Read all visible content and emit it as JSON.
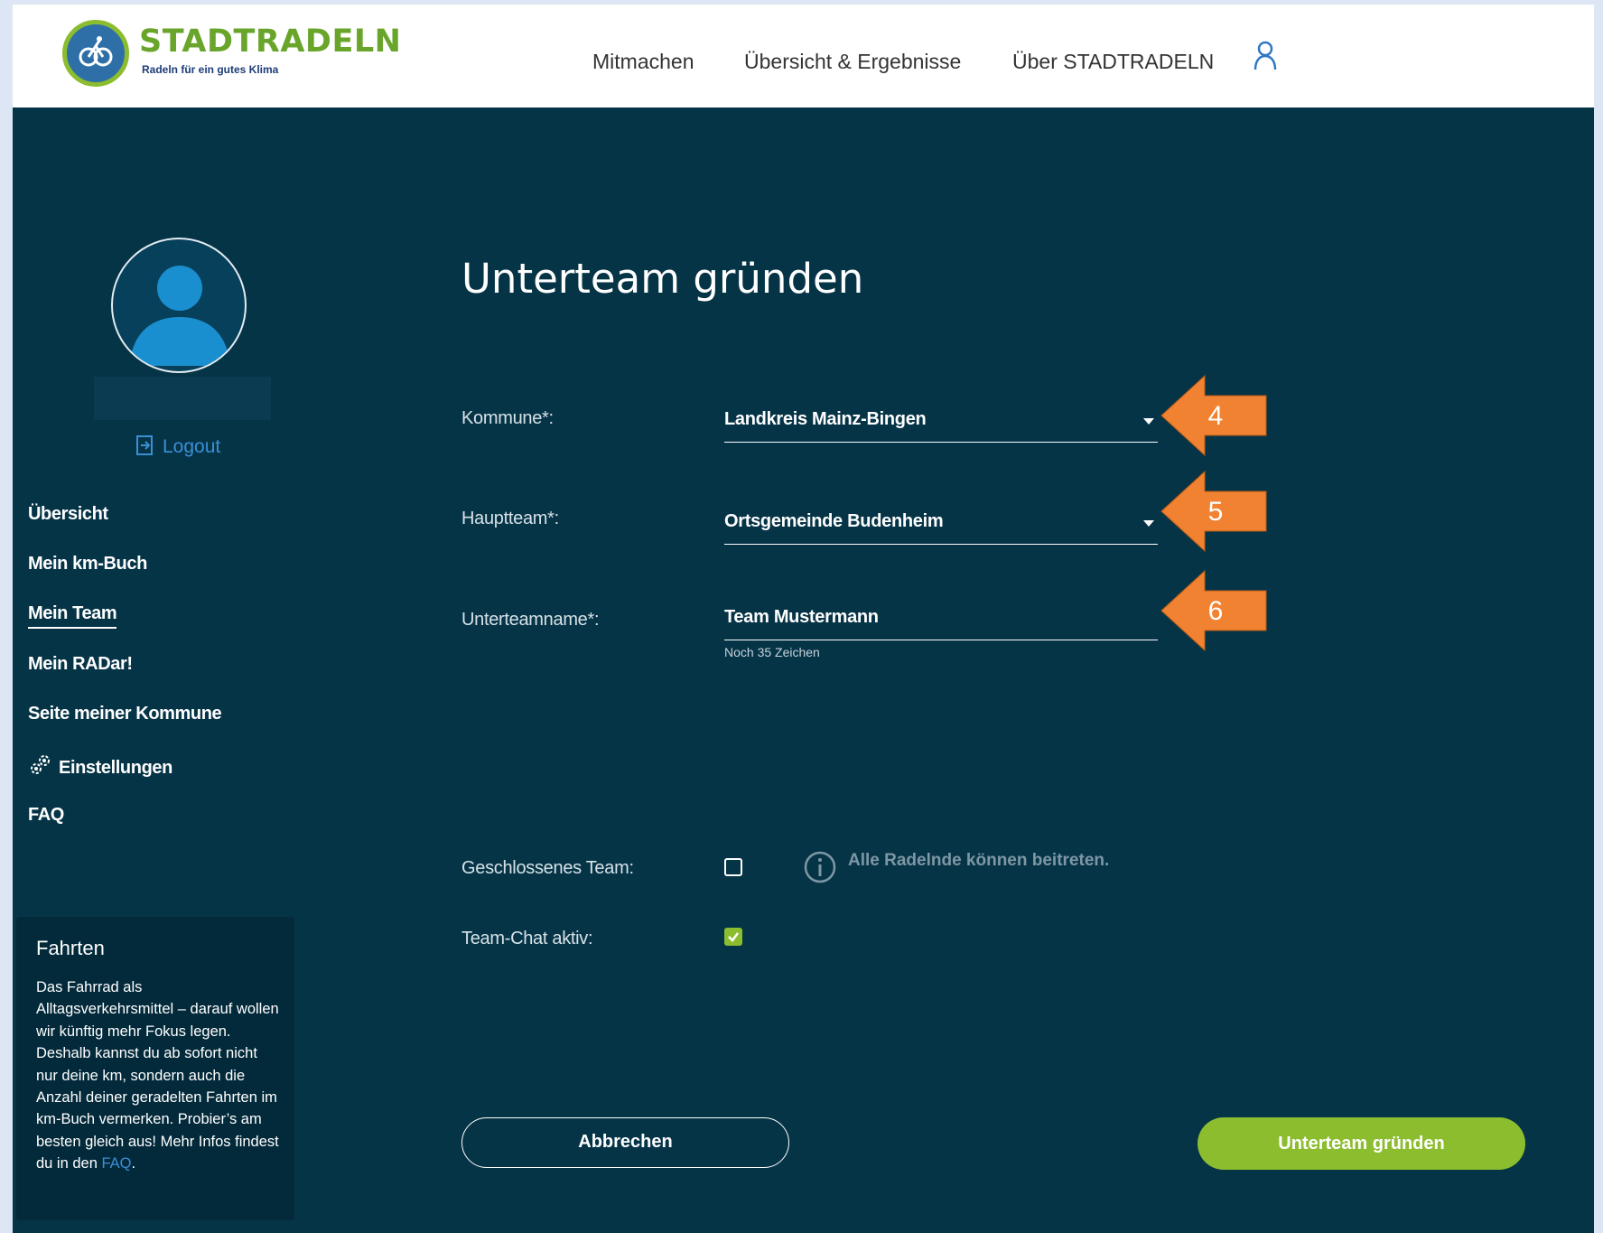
{
  "brand": {
    "name": "STADTRADELN",
    "tagline": "Radeln für ein gutes Klima",
    "colors": {
      "green": "#8cbd2f",
      "navy": "#063447",
      "blue_link": "#3a8fd6",
      "callout_orange": "#f08232"
    }
  },
  "nav": {
    "items": [
      "Mitmachen",
      "Übersicht & Ergebnisse",
      "Über STADTRADELN"
    ],
    "user_icon": "user-icon"
  },
  "sidebar": {
    "logout": "Logout",
    "items": [
      "Übersicht",
      "Mein km-Buch",
      "Mein Team",
      "Mein RADar!",
      "Seite meiner Kommune",
      "Einstellungen",
      "FAQ"
    ],
    "active": "Mein Team"
  },
  "info_box": {
    "title": "Fahrten",
    "text": "Das Fahrrad als Alltagsverkehrsmittel – darauf wollen wir künftig mehr Fokus legen. Deshalb kannst du ab sofort nicht nur deine km, sondern auch die Anzahl deiner geradelten Fahrten im km-Buch vermerken. Probier’s am besten gleich aus! Mehr Infos findest du in den ",
    "link": "FAQ",
    "tail": "."
  },
  "form": {
    "title": "Unterteam gründen",
    "kommune": {
      "label": "Kommune*:",
      "value": "Landkreis Mainz-Bingen"
    },
    "hauptteam": {
      "label": "Hauptteam*:",
      "value": "Ortsgemeinde Budenheim"
    },
    "unterteamname": {
      "label": "Unterteamname*:",
      "value": "Team Mustermann",
      "hint": "Noch 35 Zeichen"
    },
    "geschlossen": {
      "label": "Geschlossenes Team:",
      "checked": false,
      "info": "Alle Radelnde können beitreten."
    },
    "chat": {
      "label": "Team-Chat aktiv:",
      "checked": true
    },
    "cancel": "Abbrechen",
    "submit": "Unterteam gründen"
  },
  "callouts": [
    "4",
    "5",
    "6"
  ]
}
